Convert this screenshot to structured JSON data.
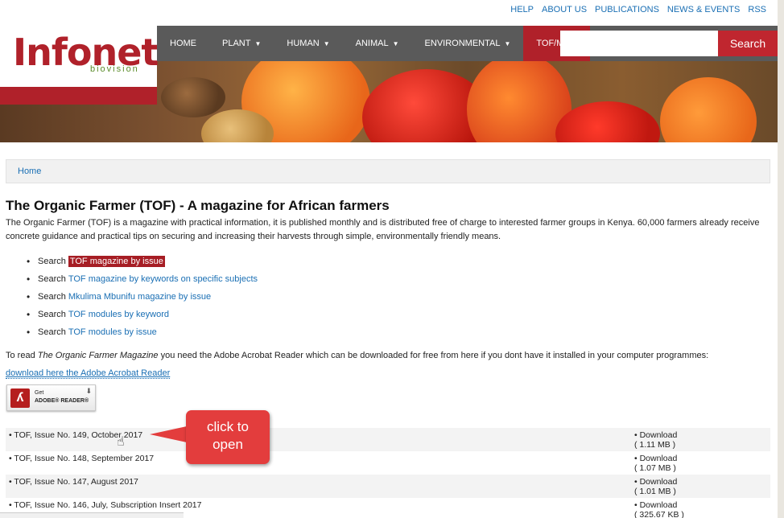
{
  "toplinks": [
    "HELP",
    "ABOUT US",
    "PUBLICATIONS",
    "NEWS & EVENTS",
    "RSS"
  ],
  "logo": {
    "word": "Infonet",
    "sub": "biovision"
  },
  "nav": {
    "home": "HOME",
    "plant": "PLANT",
    "human": "HUMAN",
    "animal": "ANIMAL",
    "environmental": "ENVIRONMENTAL",
    "tof": "TOF/MKM"
  },
  "search": {
    "button": "Search",
    "placeholder": ""
  },
  "breadcrumb": "Home",
  "title": "The Organic Farmer (TOF) - A magazine for African farmers",
  "intro": "The Organic Farmer (TOF) is a magazine with practical information, it is published monthly and is distributed free of charge to interested farmer groups in Kenya. 60,000 farmers already receive concrete guidance and practical tips on securing and increasing their harvests through simple, environmentally friendly means.",
  "search_items": [
    {
      "prefix": "Search",
      "link": "TOF magazine by issue"
    },
    {
      "prefix": "Search",
      "link": "TOF magazine by keywords on specific subjects"
    },
    {
      "prefix": "Search",
      "link": "Mkulima Mbunifu magazine by issue"
    },
    {
      "prefix": "Search",
      "link": "TOF modules by keyword"
    },
    {
      "prefix": "Search",
      "link": "TOF modules by issue"
    }
  ],
  "read": {
    "before": "To read ",
    "em": "The Organic Farmer Magazine",
    "after": " you need the Adobe Acrobat Reader which can be downloaded for free from here if you dont have it installed in your computer programmes:"
  },
  "download_reader_link": "download here the Adobe Acrobat Reader",
  "adobe_badge": {
    "get": "Get",
    "reader": "ADOBE® READER®"
  },
  "issues": [
    {
      "title": "TOF, Issue No. 149, October 2017",
      "dl": "Download",
      "size": "( 1.11 MB )"
    },
    {
      "title": "TOF, Issue No. 148, September 2017",
      "dl": "Download",
      "size": "( 1.07 MB )"
    },
    {
      "title": "TOF, Issue No. 147, August 2017",
      "dl": "Download",
      "size": "( 1.01 MB )"
    },
    {
      "title": "TOF, Issue No. 146, July, Subscription Insert 2017",
      "dl": "Download",
      "size": "( 325.67 KB )"
    }
  ],
  "callout": {
    "line1": "click to",
    "line2": "open"
  },
  "colors": {
    "brand_red": "#b0212a",
    "link_blue": "#1a6fb4",
    "nav_gray": "#5a5a5a",
    "callout_red": "#e33d3d"
  }
}
